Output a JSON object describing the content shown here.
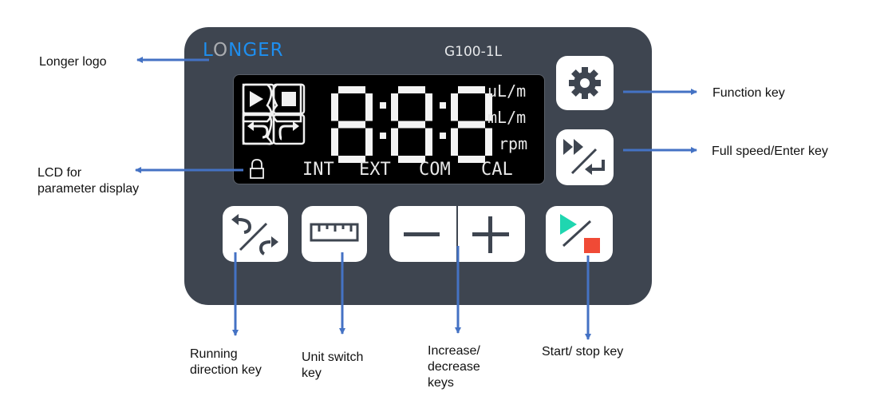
{
  "device": {
    "logo": {
      "first": "L",
      "o": "O",
      "rest": "NGER"
    },
    "model": "G100-1L",
    "lcd": {
      "digits": [
        "8",
        "8",
        "8"
      ],
      "units": [
        "uL/m",
        "mL/m",
        "rpm"
      ],
      "status": [
        "INT",
        "EXT",
        "COM",
        "CAL"
      ],
      "indicators": [
        "play-icon",
        "stop-icon",
        "ccw-arrow-icon",
        "cw-arrow-icon",
        "lock-icon"
      ]
    },
    "keys": {
      "function": "function-key",
      "full_speed_enter": "full-speed-enter-key",
      "direction": "running-direction-key",
      "unit": "unit-switch-key",
      "decrease": "decrease-key",
      "increase": "increase-key",
      "start_stop": "start-stop-key"
    }
  },
  "annotations": {
    "logo": "Longer logo",
    "lcd_line1": "LCD for",
    "lcd_line2": "parameter display",
    "function": "Function key",
    "full_speed": "Full speed/Enter key",
    "direction_line1": "Running",
    "direction_line2": "direction key",
    "unit_line1": "Unit switch",
    "unit_line2": "key",
    "incdec_line1": "Increase/",
    "incdec_line2": "decrease",
    "incdec_line3": "keys",
    "start_stop": "Start/ stop key"
  },
  "colors": {
    "panel": "#3e4550",
    "arrow": "#4472c4",
    "logo_blue": "#1e8ff0",
    "play_green": "#1fd6b0",
    "stop_red": "#f04a36"
  }
}
